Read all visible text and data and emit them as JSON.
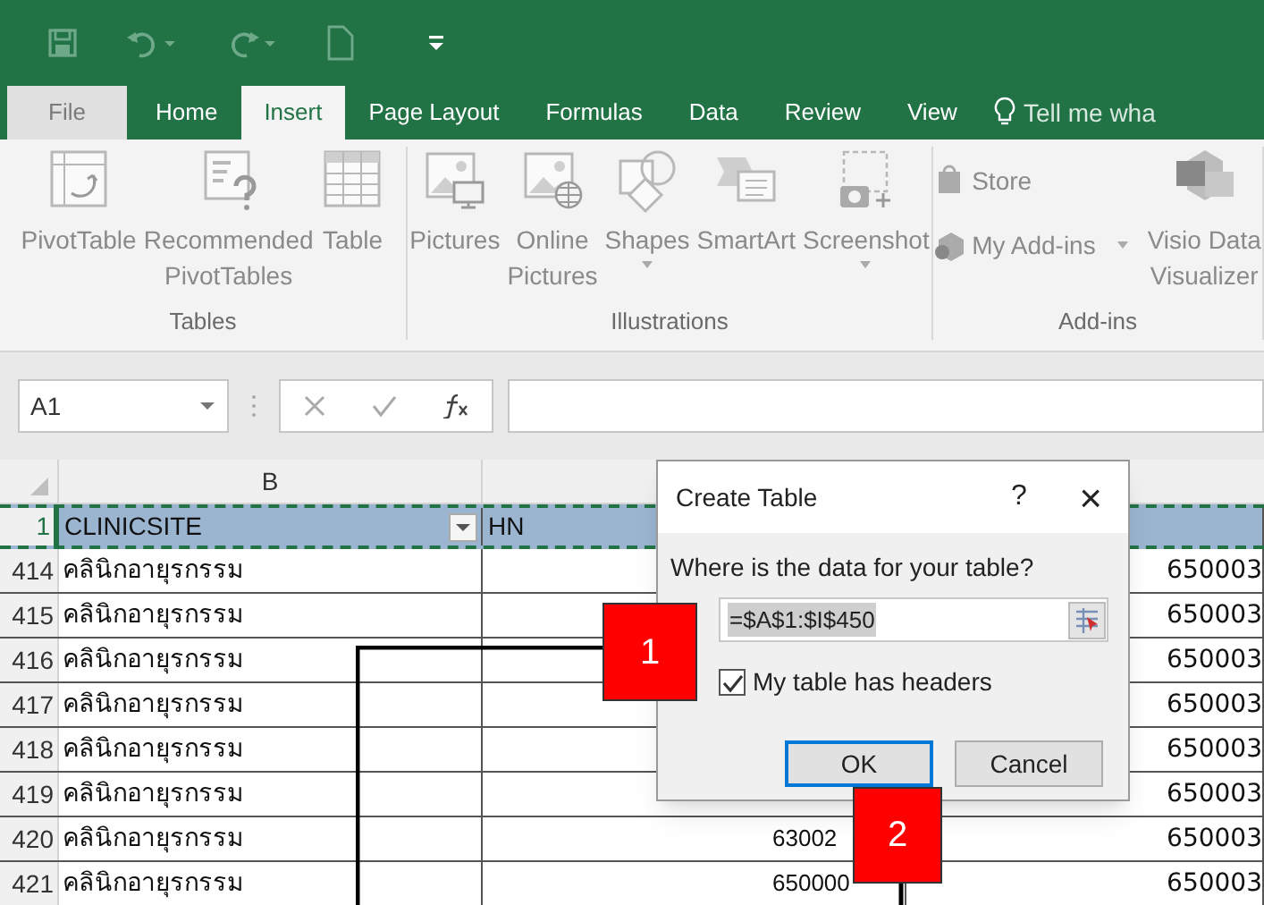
{
  "tabs": [
    {
      "label": "File",
      "kind": "file",
      "selected": false
    },
    {
      "label": "Home",
      "kind": "tab",
      "selected": false
    },
    {
      "label": "Insert",
      "kind": "tab",
      "selected": true
    },
    {
      "label": "Page Layout",
      "kind": "tab",
      "selected": false
    },
    {
      "label": "Formulas",
      "kind": "tab",
      "selected": false
    },
    {
      "label": "Data",
      "kind": "tab",
      "selected": false
    },
    {
      "label": "Review",
      "kind": "tab",
      "selected": false
    },
    {
      "label": "View",
      "kind": "tab",
      "selected": false
    }
  ],
  "tell_me": "Tell me wha",
  "ribbon": {
    "groups": [
      {
        "label": "Tables",
        "items": [
          {
            "kind": "large",
            "lines": [
              "PivotTable"
            ],
            "dropdown": false
          },
          {
            "kind": "large",
            "lines": [
              "Recommended",
              "PivotTables"
            ],
            "dropdown": false
          },
          {
            "kind": "large",
            "lines": [
              "Table"
            ],
            "dropdown": false
          }
        ]
      },
      {
        "label": "Illustrations",
        "items": [
          {
            "kind": "large",
            "lines": [
              "Pictures"
            ],
            "dropdown": false
          },
          {
            "kind": "large",
            "lines": [
              "Online",
              "Pictures"
            ],
            "dropdown": false
          },
          {
            "kind": "large",
            "lines": [
              "Shapes"
            ],
            "dropdown": true
          },
          {
            "kind": "large",
            "lines": [
              "SmartArt"
            ],
            "dropdown": false
          },
          {
            "kind": "large",
            "lines": [
              "Screenshot"
            ],
            "dropdown": true
          }
        ]
      },
      {
        "label": "Add-ins",
        "items": [
          {
            "kind": "small",
            "lines": [
              "Store"
            ],
            "dropdown": false
          },
          {
            "kind": "small",
            "lines": [
              "My Add-ins"
            ],
            "dropdown": true
          },
          {
            "kind": "large",
            "lines": [
              "Visio Data",
              "Visualizer"
            ],
            "dropdown": false
          }
        ]
      }
    ]
  },
  "formula_bar": {
    "name_box": "A1"
  },
  "sheet": {
    "column_b": "B",
    "rows": [
      {
        "number": "1",
        "header": true,
        "cells": [
          "CLINICSITE",
          "HN",
          ""
        ]
      },
      {
        "number": "414",
        "header": false,
        "cells": [
          "คลินิกอายุรกรรม",
          "",
          "650003"
        ]
      },
      {
        "number": "415",
        "header": false,
        "cells": [
          "คลินิกอายุรกรรม",
          "",
          "650003"
        ]
      },
      {
        "number": "416",
        "header": false,
        "cells": [
          "คลินิกอายุรกรรม",
          "",
          "650003"
        ]
      },
      {
        "number": "417",
        "header": false,
        "cells": [
          "คลินิกอายุรกรรม",
          "",
          "650003"
        ]
      },
      {
        "number": "418",
        "header": false,
        "cells": [
          "คลินิกอายุรกรรม",
          "",
          "650003"
        ]
      },
      {
        "number": "419",
        "header": false,
        "cells": [
          "คลินิกอายุรกรรม",
          "",
          "650003"
        ]
      },
      {
        "number": "420",
        "header": false,
        "cells": [
          "คลินิกอายุรกรรม",
          "63002",
          "650003"
        ]
      },
      {
        "number": "421",
        "header": false,
        "cells": [
          "คลินิกอายุรกรรม",
          "650000",
          "650003"
        ]
      }
    ]
  },
  "dialog": {
    "title": "Create Table",
    "help": "?",
    "close": "×",
    "prompt": "Where is the data for your table?",
    "range": "=$A$1:$I$450",
    "checkbox": {
      "label": "My table has headers",
      "checked": true
    },
    "buttons": [
      {
        "label": "OK",
        "focused": true
      },
      {
        "label": "Cancel",
        "focused": false
      }
    ]
  },
  "callouts": [
    {
      "label": "1"
    },
    {
      "label": "2"
    }
  ]
}
